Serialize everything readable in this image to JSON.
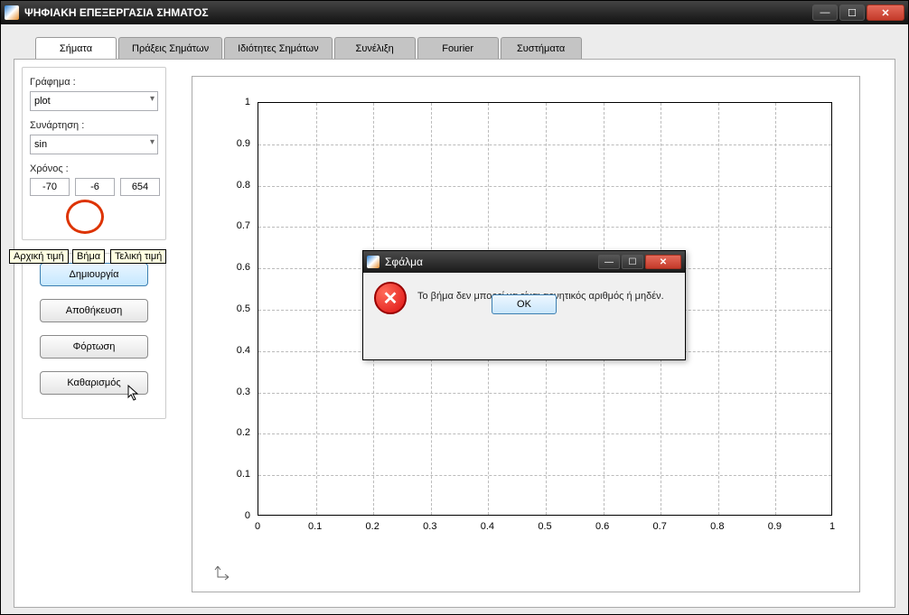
{
  "window": {
    "title": "ΨΗΦΙΑΚΗ ΕΠΕΞΕΡΓΑΣΙΑ ΣΗΜΑΤΟΣ"
  },
  "tabs": [
    {
      "label": "Σήματα",
      "active": true
    },
    {
      "label": "Πράξεις Σημάτων"
    },
    {
      "label": "Ιδιότητες Σημάτων"
    },
    {
      "label": "Συνέλιξη"
    },
    {
      "label": "Fourier"
    },
    {
      "label": "Συστήματα"
    }
  ],
  "sidebar": {
    "graph_label": "Γράφημα :",
    "graph_value": "plot",
    "func_label": "Συνάρτηση :",
    "func_value": "sin",
    "time_label": "Χρόνος :",
    "time_start": "-70",
    "time_step": "-6",
    "time_end": "654",
    "tooltip_start": "Αρχική τιμή",
    "tooltip_step": "Βήμα",
    "tooltip_end": "Τελική τιμή",
    "btn_create": "Δημιουργία",
    "btn_save": "Αποθήκευση",
    "btn_load": "Φόρτωση",
    "btn_clear": "Καθαρισμός"
  },
  "chart_data": {
    "type": "line",
    "title": "",
    "xlabel": "",
    "ylabel": "",
    "xlim": [
      0,
      1
    ],
    "ylim": [
      0,
      1
    ],
    "xticks": [
      0,
      0.1,
      0.2,
      0.3,
      0.4,
      0.5,
      0.6,
      0.7,
      0.8,
      0.9,
      1
    ],
    "yticks": [
      0,
      0.1,
      0.2,
      0.3,
      0.4,
      0.5,
      0.6,
      0.7,
      0.8,
      0.9,
      1
    ],
    "series": [],
    "grid": true
  },
  "error_dialog": {
    "title": "Σφάλμα",
    "message": "Το βήμα δεν μπορεί να είναι αρνητικός αριθμός ή μηδέν.",
    "ok": "OK"
  }
}
